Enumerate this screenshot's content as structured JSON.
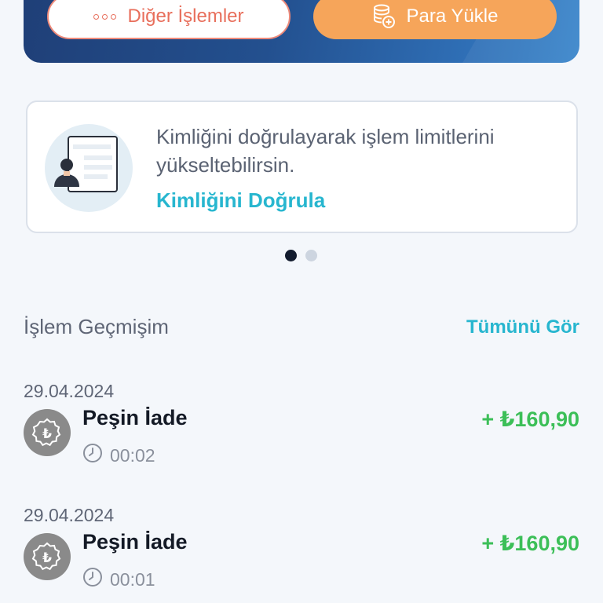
{
  "actions": {
    "other_label": "Diğer İşlemler",
    "load_label": "Para Yükle"
  },
  "verify": {
    "text": "Kimliğini doğrulayarak işlem limitlerini yükseltebilirsin.",
    "link": "Kimliğini Doğrula"
  },
  "carousel": {
    "pages": 2,
    "active": 1
  },
  "history": {
    "title": "İşlem Geçmişim",
    "see_all": "Tümünü Gör",
    "items": [
      {
        "date": "29.04.2024",
        "title": "Peşin İade",
        "time": "00:02",
        "amount": "+ ₺160,90"
      },
      {
        "date": "29.04.2024",
        "title": "Peşin İade",
        "time": "00:01",
        "amount": "+ ₺160,90"
      }
    ]
  },
  "colors": {
    "accent": "#27b6cf",
    "positive": "#3cbf58",
    "orange": "#f6a55a",
    "coral": "#e86f5c"
  }
}
